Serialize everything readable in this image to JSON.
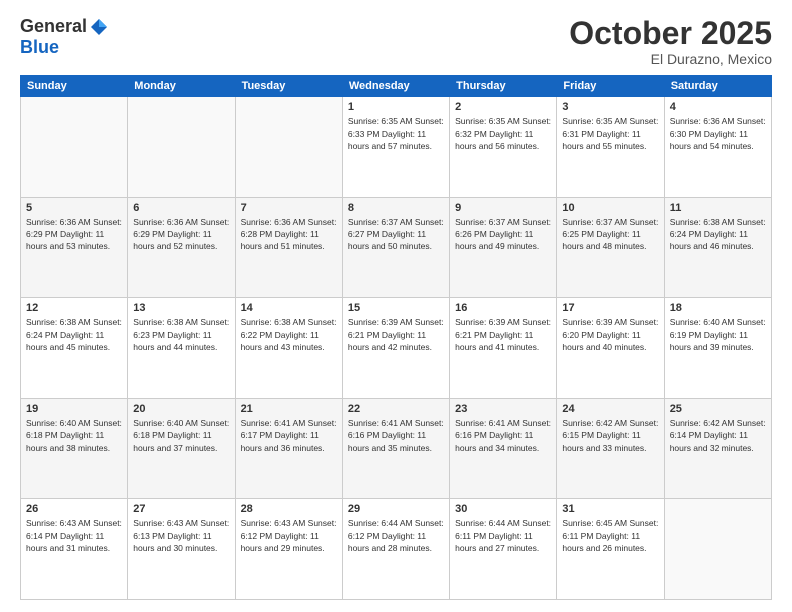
{
  "logo": {
    "general": "General",
    "blue": "Blue"
  },
  "header": {
    "month": "October 2025",
    "location": "El Durazno, Mexico"
  },
  "weekdays": [
    "Sunday",
    "Monday",
    "Tuesday",
    "Wednesday",
    "Thursday",
    "Friday",
    "Saturday"
  ],
  "weeks": [
    [
      {
        "day": "",
        "info": ""
      },
      {
        "day": "",
        "info": ""
      },
      {
        "day": "",
        "info": ""
      },
      {
        "day": "1",
        "info": "Sunrise: 6:35 AM\nSunset: 6:33 PM\nDaylight: 11 hours\nand 57 minutes."
      },
      {
        "day": "2",
        "info": "Sunrise: 6:35 AM\nSunset: 6:32 PM\nDaylight: 11 hours\nand 56 minutes."
      },
      {
        "day": "3",
        "info": "Sunrise: 6:35 AM\nSunset: 6:31 PM\nDaylight: 11 hours\nand 55 minutes."
      },
      {
        "day": "4",
        "info": "Sunrise: 6:36 AM\nSunset: 6:30 PM\nDaylight: 11 hours\nand 54 minutes."
      }
    ],
    [
      {
        "day": "5",
        "info": "Sunrise: 6:36 AM\nSunset: 6:29 PM\nDaylight: 11 hours\nand 53 minutes."
      },
      {
        "day": "6",
        "info": "Sunrise: 6:36 AM\nSunset: 6:29 PM\nDaylight: 11 hours\nand 52 minutes."
      },
      {
        "day": "7",
        "info": "Sunrise: 6:36 AM\nSunset: 6:28 PM\nDaylight: 11 hours\nand 51 minutes."
      },
      {
        "day": "8",
        "info": "Sunrise: 6:37 AM\nSunset: 6:27 PM\nDaylight: 11 hours\nand 50 minutes."
      },
      {
        "day": "9",
        "info": "Sunrise: 6:37 AM\nSunset: 6:26 PM\nDaylight: 11 hours\nand 49 minutes."
      },
      {
        "day": "10",
        "info": "Sunrise: 6:37 AM\nSunset: 6:25 PM\nDaylight: 11 hours\nand 48 minutes."
      },
      {
        "day": "11",
        "info": "Sunrise: 6:38 AM\nSunset: 6:24 PM\nDaylight: 11 hours\nand 46 minutes."
      }
    ],
    [
      {
        "day": "12",
        "info": "Sunrise: 6:38 AM\nSunset: 6:24 PM\nDaylight: 11 hours\nand 45 minutes."
      },
      {
        "day": "13",
        "info": "Sunrise: 6:38 AM\nSunset: 6:23 PM\nDaylight: 11 hours\nand 44 minutes."
      },
      {
        "day": "14",
        "info": "Sunrise: 6:38 AM\nSunset: 6:22 PM\nDaylight: 11 hours\nand 43 minutes."
      },
      {
        "day": "15",
        "info": "Sunrise: 6:39 AM\nSunset: 6:21 PM\nDaylight: 11 hours\nand 42 minutes."
      },
      {
        "day": "16",
        "info": "Sunrise: 6:39 AM\nSunset: 6:21 PM\nDaylight: 11 hours\nand 41 minutes."
      },
      {
        "day": "17",
        "info": "Sunrise: 6:39 AM\nSunset: 6:20 PM\nDaylight: 11 hours\nand 40 minutes."
      },
      {
        "day": "18",
        "info": "Sunrise: 6:40 AM\nSunset: 6:19 PM\nDaylight: 11 hours\nand 39 minutes."
      }
    ],
    [
      {
        "day": "19",
        "info": "Sunrise: 6:40 AM\nSunset: 6:18 PM\nDaylight: 11 hours\nand 38 minutes."
      },
      {
        "day": "20",
        "info": "Sunrise: 6:40 AM\nSunset: 6:18 PM\nDaylight: 11 hours\nand 37 minutes."
      },
      {
        "day": "21",
        "info": "Sunrise: 6:41 AM\nSunset: 6:17 PM\nDaylight: 11 hours\nand 36 minutes."
      },
      {
        "day": "22",
        "info": "Sunrise: 6:41 AM\nSunset: 6:16 PM\nDaylight: 11 hours\nand 35 minutes."
      },
      {
        "day": "23",
        "info": "Sunrise: 6:41 AM\nSunset: 6:16 PM\nDaylight: 11 hours\nand 34 minutes."
      },
      {
        "day": "24",
        "info": "Sunrise: 6:42 AM\nSunset: 6:15 PM\nDaylight: 11 hours\nand 33 minutes."
      },
      {
        "day": "25",
        "info": "Sunrise: 6:42 AM\nSunset: 6:14 PM\nDaylight: 11 hours\nand 32 minutes."
      }
    ],
    [
      {
        "day": "26",
        "info": "Sunrise: 6:43 AM\nSunset: 6:14 PM\nDaylight: 11 hours\nand 31 minutes."
      },
      {
        "day": "27",
        "info": "Sunrise: 6:43 AM\nSunset: 6:13 PM\nDaylight: 11 hours\nand 30 minutes."
      },
      {
        "day": "28",
        "info": "Sunrise: 6:43 AM\nSunset: 6:12 PM\nDaylight: 11 hours\nand 29 minutes."
      },
      {
        "day": "29",
        "info": "Sunrise: 6:44 AM\nSunset: 6:12 PM\nDaylight: 11 hours\nand 28 minutes."
      },
      {
        "day": "30",
        "info": "Sunrise: 6:44 AM\nSunset: 6:11 PM\nDaylight: 11 hours\nand 27 minutes."
      },
      {
        "day": "31",
        "info": "Sunrise: 6:45 AM\nSunset: 6:11 PM\nDaylight: 11 hours\nand 26 minutes."
      },
      {
        "day": "",
        "info": ""
      }
    ]
  ]
}
